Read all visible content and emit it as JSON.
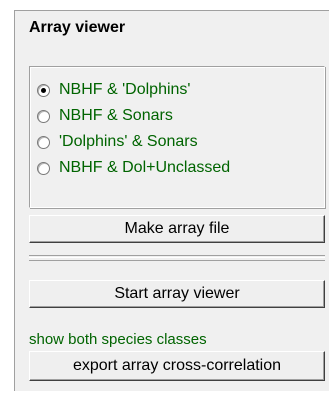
{
  "panel": {
    "title": "Array viewer",
    "radio_options": [
      {
        "label": "NBHF & 'Dolphins'",
        "selected": true
      },
      {
        "label": "NBHF & Sonars",
        "selected": false
      },
      {
        "label": "'Dolphins' & Sonars",
        "selected": false
      },
      {
        "label": "NBHF & Dol+Unclassed",
        "selected": false
      }
    ],
    "make_array_file_label": "Make array file",
    "start_array_viewer_label": "Start array viewer",
    "species_info": "show both species classes",
    "export_label": "export array cross-correlation"
  },
  "colors": {
    "label_green": "#006400",
    "panel_bg": "#f0f0f0"
  }
}
